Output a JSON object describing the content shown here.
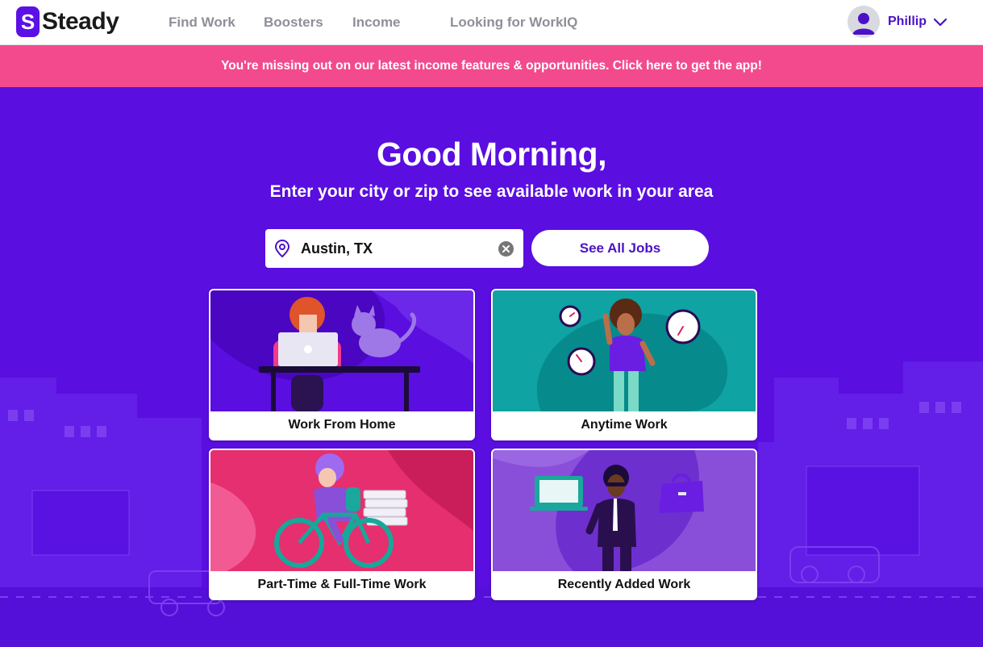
{
  "brand": {
    "logo_letter": "S",
    "name": "Steady",
    "color": "#5b11e6"
  },
  "nav": {
    "links": [
      {
        "label": "Find Work"
      },
      {
        "label": "Boosters"
      },
      {
        "label": "Income"
      },
      {
        "label": "Looking for WorkIQ"
      }
    ]
  },
  "user": {
    "name": "Phillip",
    "avatar_icon": "user-avatar-icon",
    "menu_icon": "chevron-down-icon"
  },
  "promo": {
    "text": "You're missing out on our latest income features & opportunities. Click here to get the app!",
    "color": "#f34a8e"
  },
  "hero": {
    "greeting": "Good Morning,",
    "subtitle": "Enter your city or zip to see available work in your area",
    "background": "#5a0ee0"
  },
  "search": {
    "value": "Austin, TX",
    "pin_icon": "location-pin-icon",
    "clear_icon": "clear-icon"
  },
  "see_all_button": "See All Jobs",
  "categories": [
    {
      "label": "Work From Home",
      "color": "#5a0ee0"
    },
    {
      "label": "Anytime Work",
      "color": "#0fa3a3"
    },
    {
      "label": "Part-Time & Full-Time Work",
      "color": "#e52f6e"
    },
    {
      "label": "Recently Added Work",
      "color": "#8a4fd9"
    }
  ]
}
